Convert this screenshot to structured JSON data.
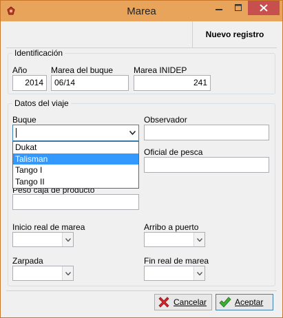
{
  "window": {
    "title": "Marea"
  },
  "toolbar": {
    "new_record_label": "Nuevo registro"
  },
  "identificacion": {
    "legend": "Identificación",
    "anio_label": "Año",
    "anio_value": "2014",
    "marea_buque_label": "Marea del buque",
    "marea_buque_value": "06/14",
    "marea_inidep_label": "Marea INIDEP",
    "marea_inidep_value": "241"
  },
  "datos_viaje": {
    "legend": "Datos del viaje",
    "buque_label": "Buque",
    "buque_value": "",
    "buque_options": [
      "Dukat",
      "Talisman",
      "Tango I",
      "Tango II"
    ],
    "buque_selected": "Talisman",
    "observador_label": "Observador",
    "observador_value": "",
    "oficial_label": "Oficial de pesca",
    "oficial_value": "",
    "peso_label": "Peso caja de producto",
    "peso_value": "",
    "inicio_label": "Inicio real de marea",
    "arribo_label": "Arribo a puerto",
    "zarpada_label": "Zarpada",
    "fin_label": "Fin real de marea"
  },
  "footer": {
    "cancel_label": "Cancelar",
    "accept_label": "Aceptar"
  },
  "icons": {
    "app": "app-icon",
    "minimize": "minimize-icon",
    "maximize": "maximize-icon",
    "close": "close-icon",
    "cancel": "red-x-icon",
    "accept": "green-check-icon"
  },
  "colors": {
    "titlebar": "#e8a45a",
    "close_button": "#c7504f",
    "selection": "#3399ff"
  }
}
